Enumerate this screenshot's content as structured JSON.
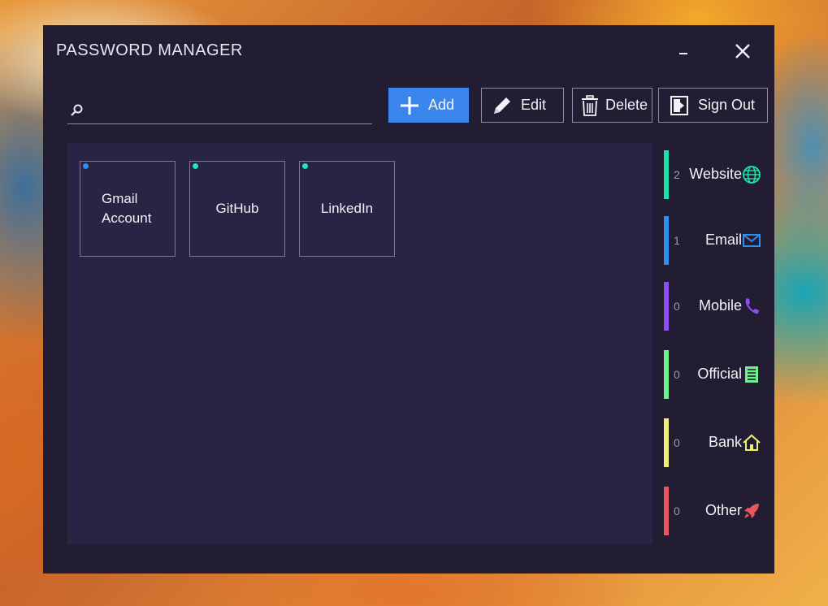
{
  "window": {
    "title": "PASSWORD MANAGER"
  },
  "search": {
    "placeholder": "",
    "value": ""
  },
  "toolbar": {
    "add_label": "Add",
    "edit_label": "Edit",
    "delete_label": "Delete",
    "signout_label": "Sign Out"
  },
  "entries": [
    {
      "line1": "Gmail",
      "line2": "Account",
      "dot_color": "#2f8ff0",
      "icon": "dot"
    },
    {
      "name": "GitHub",
      "dot_color": "#1ce4c7",
      "icon": "dot"
    },
    {
      "name": "LinkedIn",
      "dot_color": "#1ce4c7",
      "icon": "dot"
    }
  ],
  "categories": [
    {
      "label": "Website",
      "count": "2",
      "color": "#1ce4a6",
      "icon": "globe-icon"
    },
    {
      "label": "Email",
      "count": "1",
      "color": "#2f8ff0",
      "icon": "envelope-icon"
    },
    {
      "label": "Mobile",
      "count": "0",
      "color": "#8b4ff0",
      "icon": "phone-icon"
    },
    {
      "label": "Official",
      "count": "0",
      "color": "#6ef08a",
      "icon": "document-icon"
    },
    {
      "label": "Bank",
      "count": "0",
      "color": "#f3f07a",
      "icon": "home-icon"
    },
    {
      "label": "Other",
      "count": "0",
      "color": "#e8575e",
      "icon": "rocket-icon"
    }
  ]
}
